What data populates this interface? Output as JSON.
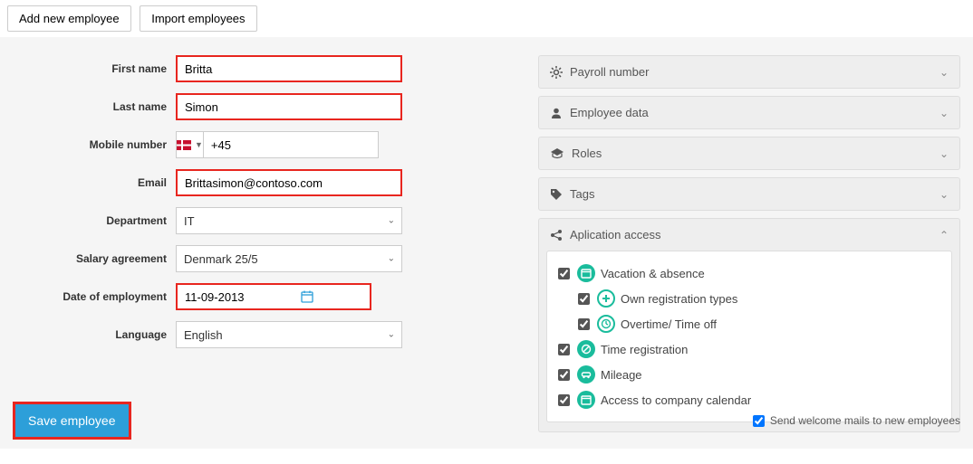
{
  "topbar": {
    "add_employee": "Add new employee",
    "import_employees": "Import employees"
  },
  "form": {
    "labels": {
      "first_name": "First name",
      "last_name": "Last name",
      "mobile": "Mobile number",
      "email": "Email",
      "department": "Department",
      "salary": "Salary agreement",
      "date_emp": "Date of employment",
      "language": "Language"
    },
    "values": {
      "first_name": "Britta",
      "last_name": "Simon",
      "phone_prefix": "+45",
      "email": "Brittasimon@contoso.com",
      "department": "IT",
      "salary": "Denmark 25/5",
      "date_emp": "11-09-2013",
      "language": "English"
    }
  },
  "accordions": {
    "payroll": "Payroll number",
    "employee_data": "Employee data",
    "roles": "Roles",
    "tags": "Tags",
    "app_access": "Aplication access"
  },
  "access_tree": [
    {
      "label": "Vacation & absence",
      "checked": true,
      "sub": false,
      "icon_type": "fill",
      "glyph": "cal"
    },
    {
      "label": "Own registration types",
      "checked": true,
      "sub": true,
      "icon_type": "out",
      "glyph": "plus"
    },
    {
      "label": "Overtime/ Time off",
      "checked": true,
      "sub": true,
      "icon_type": "out",
      "glyph": "clock"
    },
    {
      "label": "Time registration",
      "checked": true,
      "sub": false,
      "icon_type": "fill",
      "glyph": "stop"
    },
    {
      "label": "Mileage",
      "checked": true,
      "sub": false,
      "icon_type": "fill",
      "glyph": "car"
    },
    {
      "label": "Access to company calendar",
      "checked": true,
      "sub": false,
      "icon_type": "fill",
      "glyph": "cal"
    }
  ],
  "footer": {
    "save": "Save employee",
    "welcome_mail": "Send welcome mails to new employees",
    "welcome_checked": true
  }
}
